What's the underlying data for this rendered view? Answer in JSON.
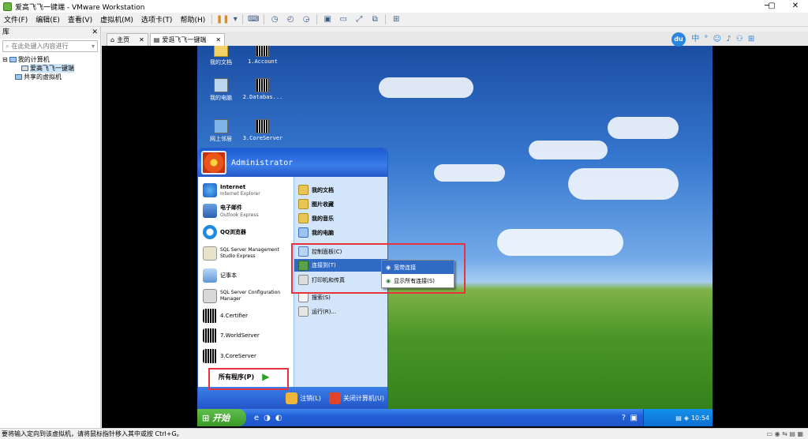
{
  "window": {
    "title": "爱高飞飞一键端 - VMware Workstation"
  },
  "menus": [
    "文件(F)",
    "编辑(E)",
    "查看(V)",
    "虚拟机(M)",
    "选项卡(T)",
    "帮助(H)"
  ],
  "library": {
    "title": "库",
    "search_placeholder": "在此处键入内容进行",
    "root": "我的计算机",
    "vm": "爱高飞飞一键端",
    "shared": "共享的虚拟机"
  },
  "tabs": {
    "home": "主页",
    "vm": "爱逛飞飞一键端"
  },
  "ime": {
    "logo": "du",
    "lang": "中"
  },
  "desktop": [
    {
      "label": "我的文档"
    },
    {
      "label": "1.Account"
    },
    {
      "label": "我的电脑"
    },
    {
      "label": "2.Databas..."
    },
    {
      "label": "网上邻居"
    },
    {
      "label": "3.CoreServer"
    }
  ],
  "startmenu": {
    "user": "Administrator",
    "pinned": [
      {
        "title": "Internet",
        "sub": "Internet Explorer"
      },
      {
        "title": "电子邮件",
        "sub": "Outlook Express"
      }
    ],
    "left": [
      "QQ浏览器",
      "SQL Server Management Studio Express",
      "记事本",
      "SQL Server Configuration Manager",
      "4.Certifier",
      "7.WorldServer",
      "3.CoreServer"
    ],
    "all_programs": "所有程序(P)",
    "right": [
      "我的文档",
      "图片收藏",
      "我的音乐",
      "我的电脑",
      "控制面板(C)",
      "连接到(T)",
      "打印机和传真",
      "搜索(S)",
      "运行(R)..."
    ],
    "logoff": "注销(L)",
    "shutdown": "关闭计算机(U)"
  },
  "submenu": [
    "宽带连接",
    "显示所有连接(S)"
  ],
  "taskbar": {
    "start": "开始",
    "clock": "10:54"
  },
  "status": "要将输入定向到该虚拟机，请将鼠标指针移入其中或按 Ctrl+G。"
}
